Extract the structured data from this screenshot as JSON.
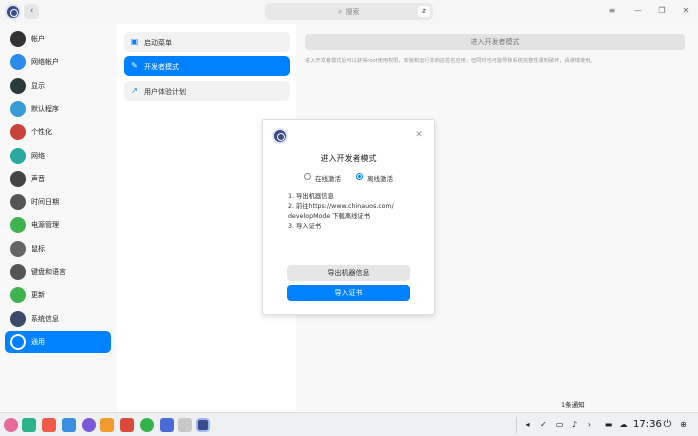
{
  "window": {
    "back_glyph": "‹",
    "search_placeholder": "搜索",
    "search_icon": "⌕",
    "voice_glyph": "⇵",
    "menu_glyph": "≡",
    "minimize_glyph": "—",
    "restore_glyph": "❐",
    "close_glyph": "✕"
  },
  "sidebar": {
    "items": [
      {
        "label": "帐户",
        "icon": "account-icon",
        "color": "#333333"
      },
      {
        "label": "网络帐户",
        "icon": "cloud-icon",
        "color": "#2a8bea"
      },
      {
        "label": "显示",
        "icon": "display-icon",
        "color": "#2b3b3b"
      },
      {
        "label": "默认程序",
        "icon": "default-apps-icon",
        "color": "#3a9bd9"
      },
      {
        "label": "个性化",
        "icon": "personalization-icon",
        "color": "#c8433a"
      },
      {
        "label": "网络",
        "icon": "network-icon",
        "color": "#29a9a0"
      },
      {
        "label": "声音",
        "icon": "sound-icon",
        "color": "#444444"
      },
      {
        "label": "时间日期",
        "icon": "clock-icon",
        "color": "#555555"
      },
      {
        "label": "电源管理",
        "icon": "power-icon",
        "color": "#3fb34f"
      },
      {
        "label": "鼠标",
        "icon": "mouse-icon",
        "color": "#666666"
      },
      {
        "label": "键盘和语言",
        "icon": "keyboard-icon",
        "color": "#555555"
      },
      {
        "label": "更新",
        "icon": "update-icon",
        "color": "#3fb34f"
      },
      {
        "label": "系统信息",
        "icon": "system-info-icon",
        "color": "#3b4a6b"
      },
      {
        "label": "通用",
        "icon": "general-icon",
        "color": "#ffffff",
        "active": true
      }
    ]
  },
  "submenu": {
    "items": [
      {
        "label": "启动菜单",
        "icon_glyph": "▣"
      },
      {
        "label": "开发者模式",
        "icon_glyph": "✎",
        "active": true
      },
      {
        "label": "用户体验计划",
        "icon_glyph": "↗"
      }
    ]
  },
  "content": {
    "dev_button_label": "进入开发者模式",
    "dev_note": "进入开发者模式后可以获得root使用权限，安装和运行非商店签名应用，但同时也可能导致系统完整性遭到破坏，请谨慎使用。",
    "notify_count": "1条通知"
  },
  "dialog": {
    "close_glyph": "✕",
    "title": "进入开发者模式",
    "options": [
      {
        "label": "在线激活",
        "checked": false
      },
      {
        "label": "离线激活",
        "checked": true
      }
    ],
    "steps": [
      "1. 导出机器信息",
      "2. 前往https://www.chinauos.com/",
      "developMode 下载离线证书",
      "3. 导入证书"
    ],
    "export_button": "导出机器信息",
    "import_button": "导入证书"
  },
  "taskbar": {
    "clock": "17:36",
    "tray_glyphs": [
      "◂",
      "✓",
      "▭",
      "♪",
      "›",
      "▬",
      "☁",
      "⏻",
      "⊕"
    ],
    "accent": "#0081ff"
  }
}
